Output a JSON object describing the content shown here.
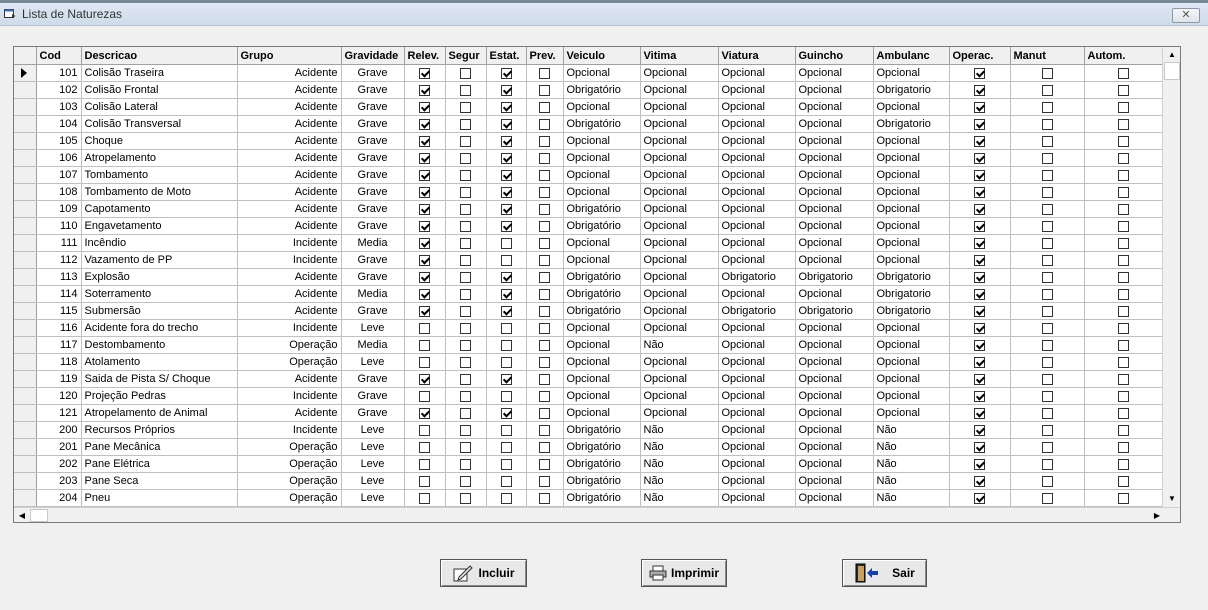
{
  "window": {
    "title": "Lista de Naturezas",
    "close_label": "✕"
  },
  "columns": [
    "Cod",
    "Descricao",
    "Grupo",
    "Gravidade",
    "Relev.",
    "Segur",
    "Estat.",
    "Prev.",
    "Veiculo",
    "Vitima",
    "Viatura",
    "Guincho",
    "Ambulanc",
    "Operac.",
    "Manut",
    "Autom."
  ],
  "rows": [
    {
      "cod": "101",
      "desc": "Colisão Traseira",
      "grupo": "Acidente",
      "grav": "Grave",
      "relev": true,
      "segur": false,
      "estat": true,
      "prev": false,
      "veiculo": "Opcional",
      "vitima": "Opcional",
      "viatura": "Opcional",
      "guincho": "Opcional",
      "ambulanc": "Opcional",
      "operac": true,
      "manut": false,
      "autom": false
    },
    {
      "cod": "102",
      "desc": "Colisão Frontal",
      "grupo": "Acidente",
      "grav": "Grave",
      "relev": true,
      "segur": false,
      "estat": true,
      "prev": false,
      "veiculo": "Obrigatório",
      "vitima": "Opcional",
      "viatura": "Opcional",
      "guincho": "Opcional",
      "ambulanc": "Obrigatorio",
      "operac": true,
      "manut": false,
      "autom": false
    },
    {
      "cod": "103",
      "desc": "Colisão Lateral",
      "grupo": "Acidente",
      "grav": "Grave",
      "relev": true,
      "segur": false,
      "estat": true,
      "prev": false,
      "veiculo": "Opcional",
      "vitima": "Opcional",
      "viatura": "Opcional",
      "guincho": "Opcional",
      "ambulanc": "Opcional",
      "operac": true,
      "manut": false,
      "autom": false
    },
    {
      "cod": "104",
      "desc": "Colisão Transversal",
      "grupo": "Acidente",
      "grav": "Grave",
      "relev": true,
      "segur": false,
      "estat": true,
      "prev": false,
      "veiculo": "Obrigatório",
      "vitima": "Opcional",
      "viatura": "Opcional",
      "guincho": "Opcional",
      "ambulanc": "Obrigatorio",
      "operac": true,
      "manut": false,
      "autom": false
    },
    {
      "cod": "105",
      "desc": "Choque",
      "grupo": "Acidente",
      "grav": "Grave",
      "relev": true,
      "segur": false,
      "estat": true,
      "prev": false,
      "veiculo": "Opcional",
      "vitima": "Opcional",
      "viatura": "Opcional",
      "guincho": "Opcional",
      "ambulanc": "Opcional",
      "operac": true,
      "manut": false,
      "autom": false
    },
    {
      "cod": "106",
      "desc": "Atropelamento",
      "grupo": "Acidente",
      "grav": "Grave",
      "relev": true,
      "segur": false,
      "estat": true,
      "prev": false,
      "veiculo": "Opcional",
      "vitima": "Opcional",
      "viatura": "Opcional",
      "guincho": "Opcional",
      "ambulanc": "Opcional",
      "operac": true,
      "manut": false,
      "autom": false
    },
    {
      "cod": "107",
      "desc": "Tombamento",
      "grupo": "Acidente",
      "grav": "Grave",
      "relev": true,
      "segur": false,
      "estat": true,
      "prev": false,
      "veiculo": "Opcional",
      "vitima": "Opcional",
      "viatura": "Opcional",
      "guincho": "Opcional",
      "ambulanc": "Opcional",
      "operac": true,
      "manut": false,
      "autom": false
    },
    {
      "cod": "108",
      "desc": "Tombamento de Moto",
      "grupo": "Acidente",
      "grav": "Grave",
      "relev": true,
      "segur": false,
      "estat": true,
      "prev": false,
      "veiculo": "Opcional",
      "vitima": "Opcional",
      "viatura": "Opcional",
      "guincho": "Opcional",
      "ambulanc": "Opcional",
      "operac": true,
      "manut": false,
      "autom": false
    },
    {
      "cod": "109",
      "desc": "Capotamento",
      "grupo": "Acidente",
      "grav": "Grave",
      "relev": true,
      "segur": false,
      "estat": true,
      "prev": false,
      "veiculo": "Obrigatório",
      "vitima": "Opcional",
      "viatura": "Opcional",
      "guincho": "Opcional",
      "ambulanc": "Opcional",
      "operac": true,
      "manut": false,
      "autom": false
    },
    {
      "cod": "110",
      "desc": "Engavetamento",
      "grupo": "Acidente",
      "grav": "Grave",
      "relev": true,
      "segur": false,
      "estat": true,
      "prev": false,
      "veiculo": "Obrigatório",
      "vitima": "Opcional",
      "viatura": "Opcional",
      "guincho": "Opcional",
      "ambulanc": "Opcional",
      "operac": true,
      "manut": false,
      "autom": false
    },
    {
      "cod": "111",
      "desc": "Incêndio",
      "grupo": "Incidente",
      "grav": "Media",
      "relev": true,
      "segur": false,
      "estat": false,
      "prev": false,
      "veiculo": "Opcional",
      "vitima": "Opcional",
      "viatura": "Opcional",
      "guincho": "Opcional",
      "ambulanc": "Opcional",
      "operac": true,
      "manut": false,
      "autom": false
    },
    {
      "cod": "112",
      "desc": "Vazamento de PP",
      "grupo": "Incidente",
      "grav": "Grave",
      "relev": true,
      "segur": false,
      "estat": false,
      "prev": false,
      "veiculo": "Opcional",
      "vitima": "Opcional",
      "viatura": "Opcional",
      "guincho": "Opcional",
      "ambulanc": "Opcional",
      "operac": true,
      "manut": false,
      "autom": false
    },
    {
      "cod": "113",
      "desc": "Explosão",
      "grupo": "Acidente",
      "grav": "Grave",
      "relev": true,
      "segur": false,
      "estat": true,
      "prev": false,
      "veiculo": "Obrigatório",
      "vitima": "Opcional",
      "viatura": "Obrigatorio",
      "guincho": "Obrigatorio",
      "ambulanc": "Obrigatorio",
      "operac": true,
      "manut": false,
      "autom": false
    },
    {
      "cod": "114",
      "desc": "Soterramento",
      "grupo": "Acidente",
      "grav": "Media",
      "relev": true,
      "segur": false,
      "estat": true,
      "prev": false,
      "veiculo": "Obrigatório",
      "vitima": "Opcional",
      "viatura": "Opcional",
      "guincho": "Opcional",
      "ambulanc": "Obrigatorio",
      "operac": true,
      "manut": false,
      "autom": false
    },
    {
      "cod": "115",
      "desc": "Submersão",
      "grupo": "Acidente",
      "grav": "Grave",
      "relev": true,
      "segur": false,
      "estat": true,
      "prev": false,
      "veiculo": "Obrigatório",
      "vitima": "Opcional",
      "viatura": "Obrigatorio",
      "guincho": "Obrigatorio",
      "ambulanc": "Obrigatorio",
      "operac": true,
      "manut": false,
      "autom": false
    },
    {
      "cod": "116",
      "desc": "Acidente fora do trecho",
      "grupo": "Incidente",
      "grav": "Leve",
      "relev": false,
      "segur": false,
      "estat": false,
      "prev": false,
      "veiculo": "Opcional",
      "vitima": "Opcional",
      "viatura": "Opcional",
      "guincho": "Opcional",
      "ambulanc": "Opcional",
      "operac": true,
      "manut": false,
      "autom": false
    },
    {
      "cod": "117",
      "desc": "Destombamento",
      "grupo": "Operação",
      "grav": "Media",
      "relev": false,
      "segur": false,
      "estat": false,
      "prev": false,
      "veiculo": "Opcional",
      "vitima": "Não",
      "viatura": "Opcional",
      "guincho": "Opcional",
      "ambulanc": "Opcional",
      "operac": true,
      "manut": false,
      "autom": false
    },
    {
      "cod": "118",
      "desc": "Atolamento",
      "grupo": "Operação",
      "grav": "Leve",
      "relev": false,
      "segur": false,
      "estat": false,
      "prev": false,
      "veiculo": "Opcional",
      "vitima": "Opcional",
      "viatura": "Opcional",
      "guincho": "Opcional",
      "ambulanc": "Opcional",
      "operac": true,
      "manut": false,
      "autom": false
    },
    {
      "cod": "119",
      "desc": "Saida de Pista S/ Choque",
      "grupo": "Acidente",
      "grav": "Grave",
      "relev": true,
      "segur": false,
      "estat": true,
      "prev": false,
      "veiculo": "Opcional",
      "vitima": "Opcional",
      "viatura": "Opcional",
      "guincho": "Opcional",
      "ambulanc": "Opcional",
      "operac": true,
      "manut": false,
      "autom": false
    },
    {
      "cod": "120",
      "desc": "Projeção Pedras",
      "grupo": "Incidente",
      "grav": "Grave",
      "relev": false,
      "segur": false,
      "estat": false,
      "prev": false,
      "veiculo": "Opcional",
      "vitima": "Opcional",
      "viatura": "Opcional",
      "guincho": "Opcional",
      "ambulanc": "Opcional",
      "operac": true,
      "manut": false,
      "autom": false
    },
    {
      "cod": "121",
      "desc": "Atropelamento de Animal",
      "grupo": "Acidente",
      "grav": "Grave",
      "relev": true,
      "segur": false,
      "estat": true,
      "prev": false,
      "veiculo": "Opcional",
      "vitima": "Opcional",
      "viatura": "Opcional",
      "guincho": "Opcional",
      "ambulanc": "Opcional",
      "operac": true,
      "manut": false,
      "autom": false
    },
    {
      "cod": "200",
      "desc": "Recursos Próprios",
      "grupo": "Incidente",
      "grav": "Leve",
      "relev": false,
      "segur": false,
      "estat": false,
      "prev": false,
      "veiculo": "Obrigatório",
      "vitima": "Não",
      "viatura": "Opcional",
      "guincho": "Opcional",
      "ambulanc": "Não",
      "operac": true,
      "manut": false,
      "autom": false
    },
    {
      "cod": "201",
      "desc": "Pane Mecânica",
      "grupo": "Operação",
      "grav": "Leve",
      "relev": false,
      "segur": false,
      "estat": false,
      "prev": false,
      "veiculo": "Obrigatório",
      "vitima": "Não",
      "viatura": "Opcional",
      "guincho": "Opcional",
      "ambulanc": "Não",
      "operac": true,
      "manut": false,
      "autom": false
    },
    {
      "cod": "202",
      "desc": "Pane Elétrica",
      "grupo": "Operação",
      "grav": "Leve",
      "relev": false,
      "segur": false,
      "estat": false,
      "prev": false,
      "veiculo": "Obrigatório",
      "vitima": "Não",
      "viatura": "Opcional",
      "guincho": "Opcional",
      "ambulanc": "Não",
      "operac": true,
      "manut": false,
      "autom": false
    },
    {
      "cod": "203",
      "desc": "Pane Seca",
      "grupo": "Operação",
      "grav": "Leve",
      "relev": false,
      "segur": false,
      "estat": false,
      "prev": false,
      "veiculo": "Obrigatório",
      "vitima": "Não",
      "viatura": "Opcional",
      "guincho": "Opcional",
      "ambulanc": "Não",
      "operac": true,
      "manut": false,
      "autom": false
    },
    {
      "cod": "204",
      "desc": "Pneu",
      "grupo": "Operação",
      "grav": "Leve",
      "relev": false,
      "segur": false,
      "estat": false,
      "prev": false,
      "veiculo": "Obrigatório",
      "vitima": "Não",
      "viatura": "Opcional",
      "guincho": "Opcional",
      "ambulanc": "Não",
      "operac": true,
      "manut": false,
      "autom": false
    }
  ],
  "buttons": {
    "incluir": "Incluir",
    "imprimir": "Imprimir",
    "sair": "Sair"
  },
  "icons": {
    "window": "form-icon",
    "incluir": "pencil-icon",
    "imprimir": "printer-icon",
    "sair": "exit-door-icon"
  }
}
